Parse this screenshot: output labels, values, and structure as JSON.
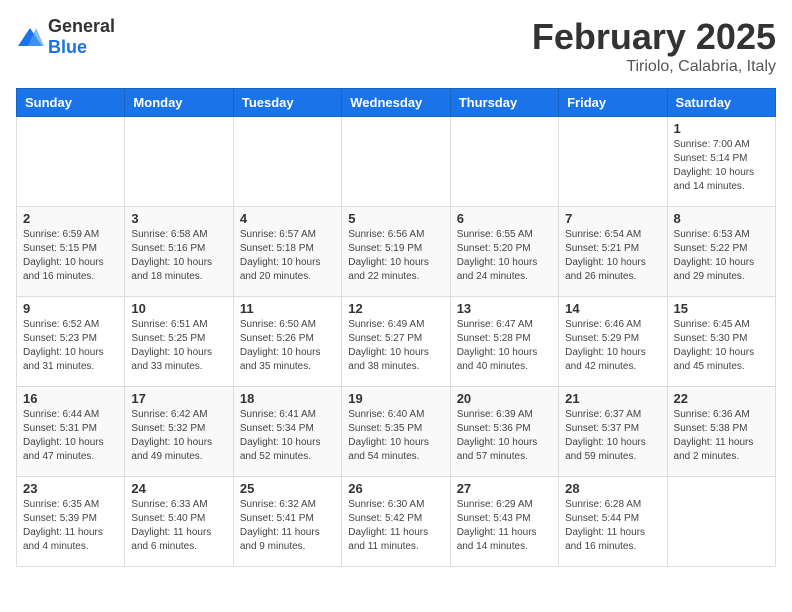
{
  "header": {
    "logo_general": "General",
    "logo_blue": "Blue",
    "month": "February 2025",
    "location": "Tiriolo, Calabria, Italy"
  },
  "days_of_week": [
    "Sunday",
    "Monday",
    "Tuesday",
    "Wednesday",
    "Thursday",
    "Friday",
    "Saturday"
  ],
  "weeks": [
    [
      {
        "day": "",
        "info": ""
      },
      {
        "day": "",
        "info": ""
      },
      {
        "day": "",
        "info": ""
      },
      {
        "day": "",
        "info": ""
      },
      {
        "day": "",
        "info": ""
      },
      {
        "day": "",
        "info": ""
      },
      {
        "day": "1",
        "info": "Sunrise: 7:00 AM\nSunset: 5:14 PM\nDaylight: 10 hours\nand 14 minutes."
      }
    ],
    [
      {
        "day": "2",
        "info": "Sunrise: 6:59 AM\nSunset: 5:15 PM\nDaylight: 10 hours\nand 16 minutes."
      },
      {
        "day": "3",
        "info": "Sunrise: 6:58 AM\nSunset: 5:16 PM\nDaylight: 10 hours\nand 18 minutes."
      },
      {
        "day": "4",
        "info": "Sunrise: 6:57 AM\nSunset: 5:18 PM\nDaylight: 10 hours\nand 20 minutes."
      },
      {
        "day": "5",
        "info": "Sunrise: 6:56 AM\nSunset: 5:19 PM\nDaylight: 10 hours\nand 22 minutes."
      },
      {
        "day": "6",
        "info": "Sunrise: 6:55 AM\nSunset: 5:20 PM\nDaylight: 10 hours\nand 24 minutes."
      },
      {
        "day": "7",
        "info": "Sunrise: 6:54 AM\nSunset: 5:21 PM\nDaylight: 10 hours\nand 26 minutes."
      },
      {
        "day": "8",
        "info": "Sunrise: 6:53 AM\nSunset: 5:22 PM\nDaylight: 10 hours\nand 29 minutes."
      }
    ],
    [
      {
        "day": "9",
        "info": "Sunrise: 6:52 AM\nSunset: 5:23 PM\nDaylight: 10 hours\nand 31 minutes."
      },
      {
        "day": "10",
        "info": "Sunrise: 6:51 AM\nSunset: 5:25 PM\nDaylight: 10 hours\nand 33 minutes."
      },
      {
        "day": "11",
        "info": "Sunrise: 6:50 AM\nSunset: 5:26 PM\nDaylight: 10 hours\nand 35 minutes."
      },
      {
        "day": "12",
        "info": "Sunrise: 6:49 AM\nSunset: 5:27 PM\nDaylight: 10 hours\nand 38 minutes."
      },
      {
        "day": "13",
        "info": "Sunrise: 6:47 AM\nSunset: 5:28 PM\nDaylight: 10 hours\nand 40 minutes."
      },
      {
        "day": "14",
        "info": "Sunrise: 6:46 AM\nSunset: 5:29 PM\nDaylight: 10 hours\nand 42 minutes."
      },
      {
        "day": "15",
        "info": "Sunrise: 6:45 AM\nSunset: 5:30 PM\nDaylight: 10 hours\nand 45 minutes."
      }
    ],
    [
      {
        "day": "16",
        "info": "Sunrise: 6:44 AM\nSunset: 5:31 PM\nDaylight: 10 hours\nand 47 minutes."
      },
      {
        "day": "17",
        "info": "Sunrise: 6:42 AM\nSunset: 5:32 PM\nDaylight: 10 hours\nand 49 minutes."
      },
      {
        "day": "18",
        "info": "Sunrise: 6:41 AM\nSunset: 5:34 PM\nDaylight: 10 hours\nand 52 minutes."
      },
      {
        "day": "19",
        "info": "Sunrise: 6:40 AM\nSunset: 5:35 PM\nDaylight: 10 hours\nand 54 minutes."
      },
      {
        "day": "20",
        "info": "Sunrise: 6:39 AM\nSunset: 5:36 PM\nDaylight: 10 hours\nand 57 minutes."
      },
      {
        "day": "21",
        "info": "Sunrise: 6:37 AM\nSunset: 5:37 PM\nDaylight: 10 hours\nand 59 minutes."
      },
      {
        "day": "22",
        "info": "Sunrise: 6:36 AM\nSunset: 5:38 PM\nDaylight: 11 hours\nand 2 minutes."
      }
    ],
    [
      {
        "day": "23",
        "info": "Sunrise: 6:35 AM\nSunset: 5:39 PM\nDaylight: 11 hours\nand 4 minutes."
      },
      {
        "day": "24",
        "info": "Sunrise: 6:33 AM\nSunset: 5:40 PM\nDaylight: 11 hours\nand 6 minutes."
      },
      {
        "day": "25",
        "info": "Sunrise: 6:32 AM\nSunset: 5:41 PM\nDaylight: 11 hours\nand 9 minutes."
      },
      {
        "day": "26",
        "info": "Sunrise: 6:30 AM\nSunset: 5:42 PM\nDaylight: 11 hours\nand 11 minutes."
      },
      {
        "day": "27",
        "info": "Sunrise: 6:29 AM\nSunset: 5:43 PM\nDaylight: 11 hours\nand 14 minutes."
      },
      {
        "day": "28",
        "info": "Sunrise: 6:28 AM\nSunset: 5:44 PM\nDaylight: 11 hours\nand 16 minutes."
      },
      {
        "day": "",
        "info": ""
      }
    ]
  ]
}
